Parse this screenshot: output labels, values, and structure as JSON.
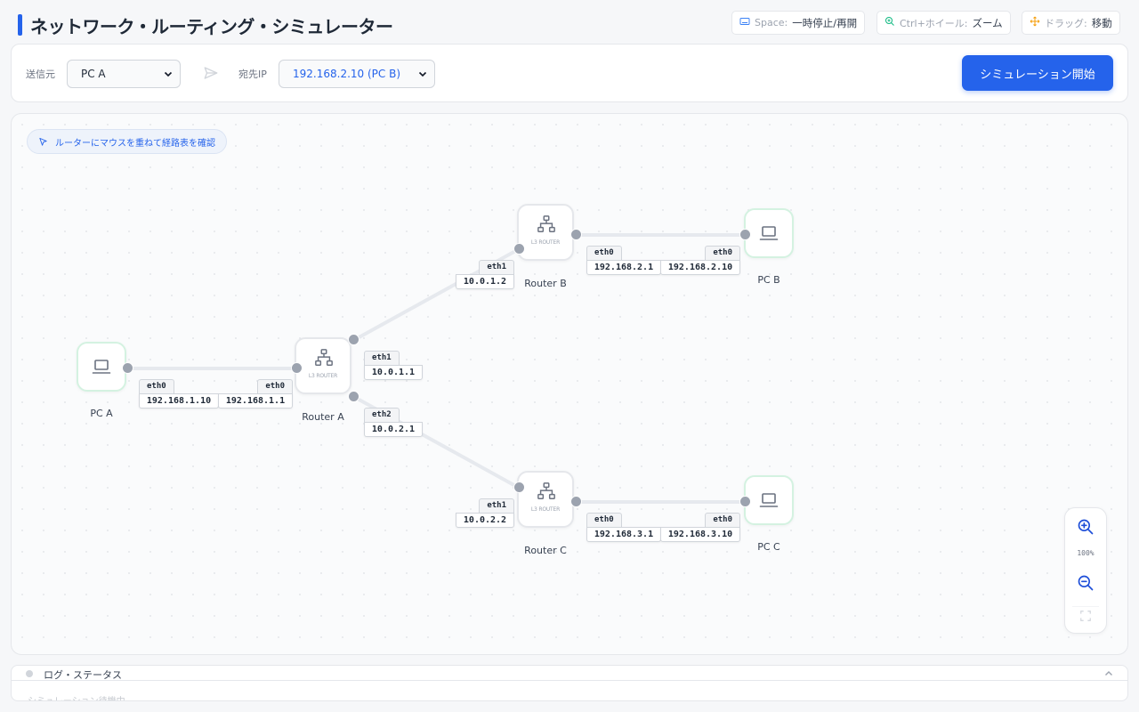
{
  "header": {
    "title": "ネットワーク・ルーティング・シミュレーター",
    "hints": [
      {
        "key": "Space:",
        "value": "一時停止/再開",
        "icon": "keyboard-icon",
        "color": "#3b82f6"
      },
      {
        "key": "Ctrl+ホイール:",
        "value": "ズーム",
        "icon": "zoom-icon",
        "color": "#10b981"
      },
      {
        "key": "ドラッグ:",
        "value": "移動",
        "icon": "move-icon",
        "color": "#f59e0b"
      }
    ]
  },
  "toolbar": {
    "source_label": "送信元",
    "source_value": "PC A",
    "dest_label": "宛先IP",
    "dest_value": "192.168.2.10 (PC B)",
    "start_label": "シミュレーション開始"
  },
  "canvas": {
    "hint": "ルーターにマウスを重ねて経路表を確認",
    "router_type": "L3 ROUTER",
    "nodes": {
      "pc_a": "PC A",
      "pc_b": "PC B",
      "pc_c": "PC C",
      "router_a": "Router A",
      "router_b": "Router B",
      "router_c": "Router C"
    },
    "interfaces": {
      "pc_a_eth0": {
        "name": "eth0",
        "ip": "192.168.1.10"
      },
      "ra_eth0": {
        "name": "eth0",
        "ip": "192.168.1.1"
      },
      "ra_eth1": {
        "name": "eth1",
        "ip": "10.0.1.1"
      },
      "ra_eth2": {
        "name": "eth2",
        "ip": "10.0.2.1"
      },
      "rb_eth1": {
        "name": "eth1",
        "ip": "10.0.1.2"
      },
      "rb_eth0": {
        "name": "eth0",
        "ip": "192.168.2.1"
      },
      "pc_b_eth0": {
        "name": "eth0",
        "ip": "192.168.2.10"
      },
      "rc_eth1": {
        "name": "eth1",
        "ip": "10.0.2.2"
      },
      "rc_eth0": {
        "name": "eth0",
        "ip": "192.168.3.1"
      },
      "pc_c_eth0": {
        "name": "eth0",
        "ip": "192.168.3.10"
      }
    }
  },
  "zoom": {
    "level": "100%"
  },
  "log": {
    "title": "ログ・ステータス",
    "line": "シミュレーション待機中"
  },
  "colors": {
    "accent": "#2563eb",
    "pc_border": "#d4f2e1",
    "port": "#9ca3af"
  }
}
